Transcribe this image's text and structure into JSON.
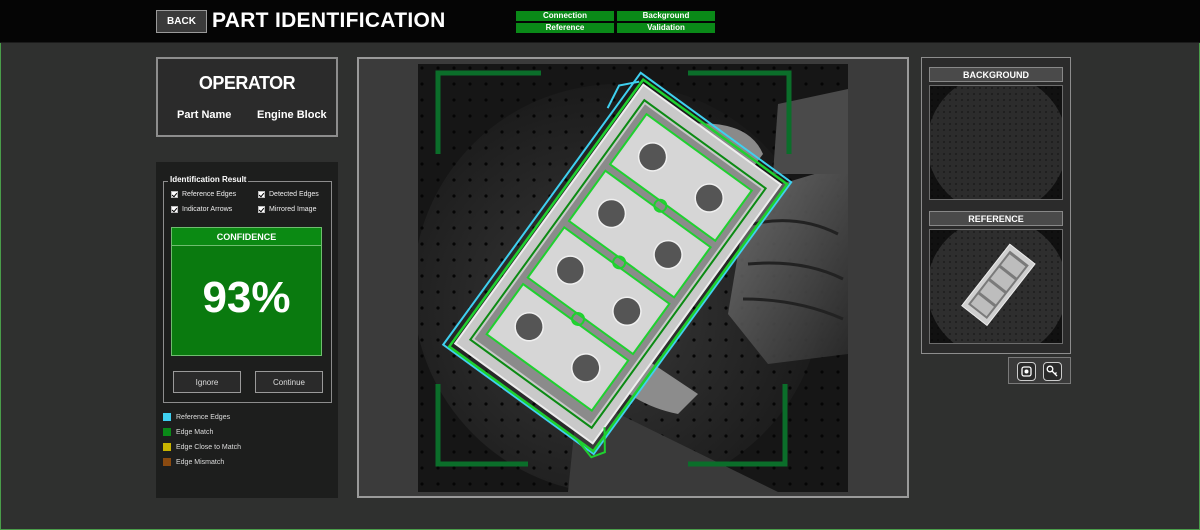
{
  "header": {
    "back_label": "BACK",
    "title": "PART IDENTIFICATION",
    "status": [
      {
        "label": "Connection",
        "color": "#0a8a18"
      },
      {
        "label": "Background",
        "color": "#0a8a18"
      },
      {
        "label": "Reference",
        "color": "#0a8a18"
      },
      {
        "label": "Validation",
        "color": "#0a8a18"
      }
    ]
  },
  "operator": {
    "title": "OPERATOR",
    "part_name_label": "Part Name",
    "part_name_value": "Engine Block"
  },
  "result": {
    "legend": "Identification Result",
    "options": [
      {
        "label": "Reference Edges",
        "checked": true
      },
      {
        "label": "Detected Edges",
        "checked": true
      },
      {
        "label": "Indicator Arrows",
        "checked": true
      },
      {
        "label": "Mirrored Image",
        "checked": true
      }
    ],
    "confidence_label": "CONFIDENCE",
    "confidence_value": "93%",
    "confidence_fraction": 0.93,
    "ignore_label": "Ignore",
    "continue_label": "Continue"
  },
  "edge_legend": [
    {
      "label": "Reference Edges",
      "color": "#3fd0f0"
    },
    {
      "label": "Edge Match",
      "color": "#0a8a18"
    },
    {
      "label": "Edge Close to Match",
      "color": "#c8b400"
    },
    {
      "label": "Edge Mismatch",
      "color": "#8a4a10"
    }
  ],
  "side": {
    "background_label": "BACKGROUND",
    "reference_label": "REFERENCE"
  },
  "tools": {
    "icons": [
      "camera-settings-icon",
      "key-icon"
    ]
  },
  "colors": {
    "accent_green": "#0a8a18",
    "reference_cyan": "#3fd0f0",
    "match_green": "#1fd12f"
  }
}
